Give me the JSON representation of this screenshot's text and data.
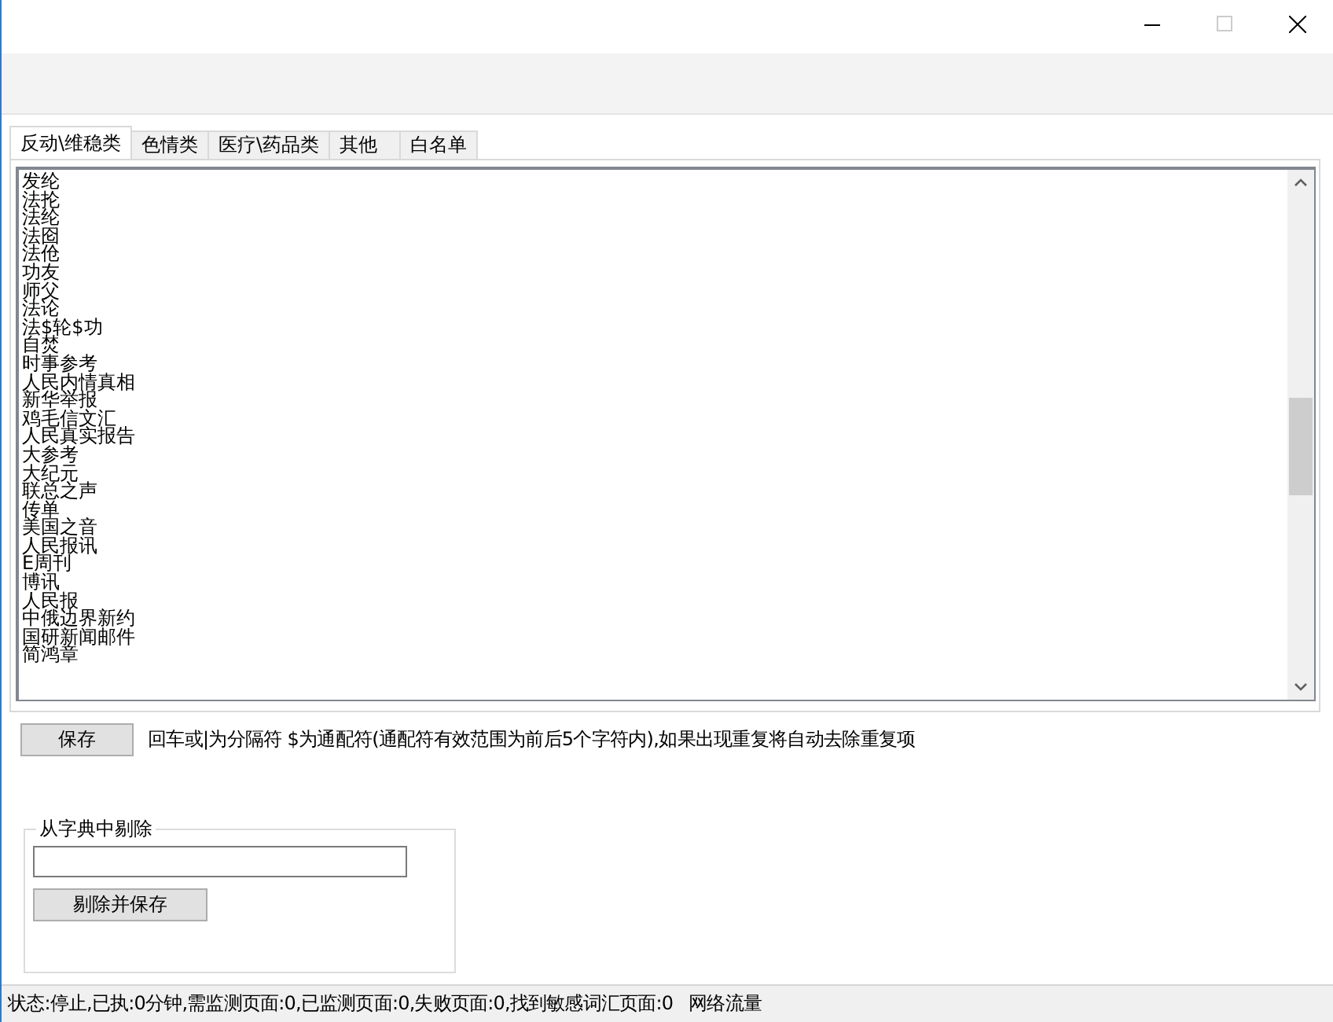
{
  "tabs": [
    {
      "label": "反动\\维稳类",
      "selected": true
    },
    {
      "label": "色情类",
      "selected": false
    },
    {
      "label": "医疗\\药品类",
      "selected": false
    },
    {
      "label": "其他",
      "selected": false
    },
    {
      "label": "白名单",
      "selected": false
    }
  ],
  "word_list": [
    "发纶",
    "法抡",
    "法纶",
    "法囵",
    "法伧",
    "功友",
    "师父",
    "法论",
    "法$轮$功",
    "自焚",
    "时事参考",
    "人民内情真相",
    "新华举报",
    "鸡毛信文汇",
    "人民真实报告",
    "大参考",
    "大纪元",
    "联总之声",
    "传单",
    "美国之音",
    "人民报讯",
    "E周刊",
    "博讯",
    "人民报",
    "中俄边界新约",
    "国研新闻邮件",
    "简鸿章"
  ],
  "save_button": "保存",
  "hint": "回车或|为分隔符  $为通配符(通配符有效范围为前后5个字符内),如果出现重复将自动去除重复项",
  "remove_group": {
    "legend": "从字典中剔除",
    "button": "剔除并保存"
  },
  "status_bar": {
    "status": "状态:停止,已执:0分钟,需监测页面:0,已监测页面:0,失败页面:0,找到敏感词汇页面:0",
    "traffic": "网络流量"
  }
}
